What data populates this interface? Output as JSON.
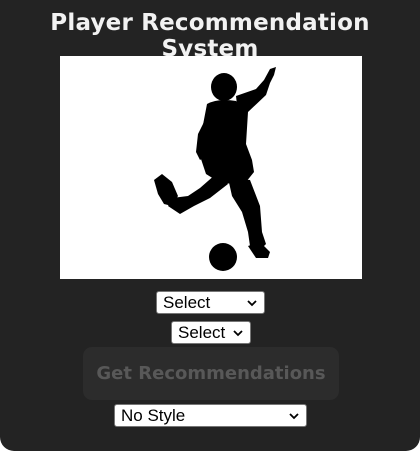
{
  "app": {
    "title": "Player Recommendation System"
  },
  "image": {
    "icon": "soccer-player-kicking-ball-silhouette",
    "background": "#ffffff",
    "silhouette_color": "#000000"
  },
  "controls": {
    "select_primary": {
      "value": "Select"
    },
    "select_secondary": {
      "value": "Select"
    },
    "recommend_button": {
      "label": "Get Recommendations",
      "state": "disabled"
    },
    "style_select": {
      "value": "No Style"
    }
  },
  "colors": {
    "panel_background": "#232323",
    "title_text": "#f2f2f2",
    "button_background": "#2c2c2c",
    "button_text_disabled": "#585858"
  }
}
